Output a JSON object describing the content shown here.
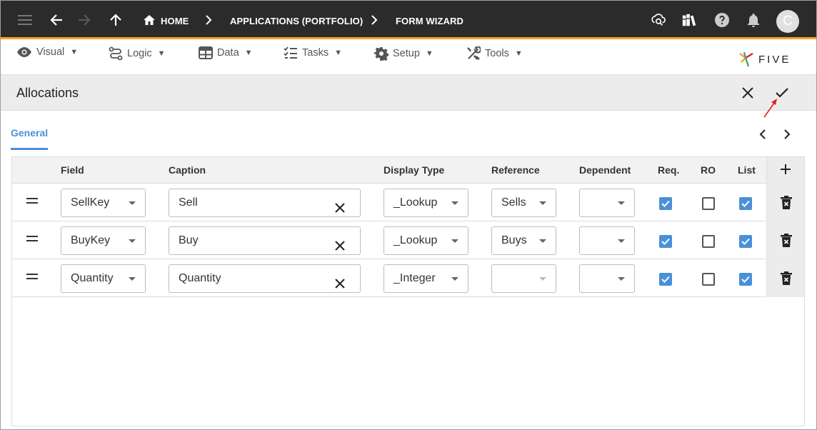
{
  "topbar": {
    "breadcrumbs": [
      "HOME",
      "APPLICATIONS (PORTFOLIO)",
      "FORM WIZARD"
    ],
    "avatar_initial": "C"
  },
  "menu": {
    "items": [
      {
        "label": "Visual"
      },
      {
        "label": "Logic"
      },
      {
        "label": "Data"
      },
      {
        "label": "Tasks"
      },
      {
        "label": "Setup"
      },
      {
        "label": "Tools"
      }
    ],
    "logo_text": "FIVE"
  },
  "form": {
    "title": "Allocations",
    "tab": "General"
  },
  "grid": {
    "headers": {
      "field": "Field",
      "caption": "Caption",
      "display_type": "Display Type",
      "reference": "Reference",
      "dependent": "Dependent",
      "req": "Req.",
      "ro": "RO",
      "list": "List"
    },
    "rows": [
      {
        "field": "SellKey",
        "caption": "Sell",
        "display_type": "_Lookup",
        "reference": "Sells",
        "dependent": "",
        "req": true,
        "ro": false,
        "list": true
      },
      {
        "field": "BuyKey",
        "caption": "Buy",
        "display_type": "_Lookup",
        "reference": "Buys",
        "dependent": "",
        "req": true,
        "ro": false,
        "list": true
      },
      {
        "field": "Quantity",
        "caption": "Quantity",
        "display_type": "_Integer",
        "reference": "",
        "dependent": "",
        "req": true,
        "ro": false,
        "list": true
      }
    ]
  },
  "colors": {
    "topbar": "#2b2b2b",
    "accent_line": "#f5a623",
    "checkbox": "#4a90d9",
    "tab": "#4a90d9",
    "annotation_arrow": "#e02020"
  }
}
